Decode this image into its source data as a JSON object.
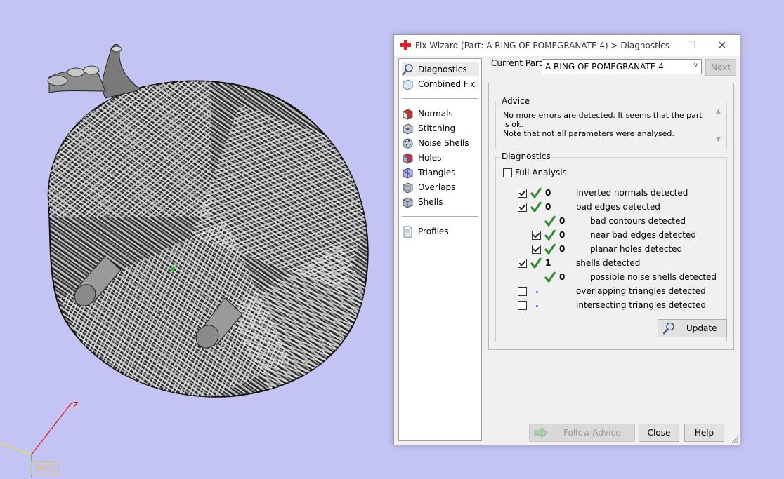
{
  "viewport": {
    "wcs_label": "WCS",
    "z_label": "Z",
    "background": "#c4c4f4"
  },
  "dialog": {
    "title": "Fix Wizard (Part: A RING OF POMEGRANATE 4) > Diagnostics",
    "nav": {
      "top": [
        "Diagnostics",
        "Combined Fix"
      ],
      "tools": [
        "Normals",
        "Stitching",
        "Noise Shells",
        "Holes",
        "Triangles",
        "Overlaps",
        "Shells"
      ],
      "bottom": [
        "Profiles"
      ],
      "selected": "Diagnostics"
    },
    "current_part_label": "Current Part:",
    "current_part_value": "A RING OF POMEGRANATE 4",
    "next_label": "Next",
    "advice": {
      "title": "Advice",
      "line1": "No more errors are detected. It seems that the part is ok.",
      "line2": "Note that not all parameters were analysed."
    },
    "diagnostics": {
      "title": "Diagnostics",
      "full_analysis_label": "Full Analysis",
      "full_analysis_checked": false,
      "rows": [
        {
          "count": "0",
          "label": "inverted normals detected",
          "checked": true,
          "status": "ok"
        },
        {
          "count": "0",
          "label": "bad edges detected",
          "checked": true,
          "status": "ok"
        },
        {
          "count": "0",
          "label": "bad contours detected",
          "checked": null,
          "status": "ok"
        },
        {
          "count": "0",
          "label": "near bad edges detected",
          "checked": true,
          "status": "ok"
        },
        {
          "count": "0",
          "label": "planar holes detected",
          "checked": true,
          "status": "ok"
        },
        {
          "count": "1",
          "label": "shells detected",
          "checked": true,
          "status": "ok"
        },
        {
          "count": "0",
          "label": "possible noise shells detected",
          "checked": null,
          "status": "ok"
        },
        {
          "count": "",
          "label": "overlapping triangles detected",
          "checked": false,
          "status": "pending"
        },
        {
          "count": "",
          "label": "intersecting triangles detected",
          "checked": false,
          "status": "pending"
        }
      ],
      "update_label": "Update"
    },
    "buttons": {
      "follow_advice": "Follow Advice",
      "close": "Close",
      "help": "Help"
    }
  },
  "colors": {
    "ok_tick": "#2f8a2f",
    "pending_dot": "#2060d0",
    "title_icon": "#e02020"
  }
}
